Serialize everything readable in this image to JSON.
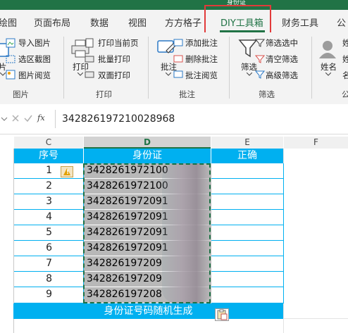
{
  "window": {
    "title": "身份证"
  },
  "tabs": [
    {
      "label": "绘图"
    },
    {
      "label": "页面布局"
    },
    {
      "label": "数据"
    },
    {
      "label": "视图"
    },
    {
      "label": "方方格子"
    },
    {
      "label": "DIY工具箱"
    },
    {
      "label": "财务工具"
    },
    {
      "label": "公"
    }
  ],
  "ribbon": {
    "picture": {
      "import": "导入图片",
      "area_screenshot": "选区截图",
      "browse": "图片阅览",
      "left_fragment": "片",
      "group": "图片"
    },
    "print": {
      "print": "打印",
      "print_current_page": "打印当前页",
      "batch_print": "批量打印",
      "duplex_print": "双面打印",
      "group": "打印"
    },
    "comment": {
      "comment": "批注",
      "add": "添加批注",
      "delete": "删除批注",
      "browse": "批注阅览",
      "group": "批注"
    },
    "filter": {
      "filter": "筛选",
      "filtered": "筛选选中",
      "clear": "清空筛选",
      "advanced": "高级筛选",
      "group": "筛选"
    },
    "name": {
      "name": "姓名",
      "frag1": "姓",
      "frag2": "姓",
      "frag3": "名",
      "group": "公"
    }
  },
  "formula_bar": {
    "fx": "fx",
    "value": "342826197210028968"
  },
  "columns": [
    "C",
    "D",
    "E",
    "F"
  ],
  "sheet": {
    "headers": {
      "seq": "序号",
      "id": "身份证",
      "correct": "正确"
    },
    "rows": [
      {
        "num": "1",
        "id": "3428261972100"
      },
      {
        "num": "2",
        "id": "3428261972100"
      },
      {
        "num": "3",
        "id": "3428261972091"
      },
      {
        "num": "4",
        "id": "3428261972091"
      },
      {
        "num": "5",
        "id": "3428261972091"
      },
      {
        "num": "6",
        "id": "3428261972091"
      },
      {
        "num": "7",
        "id": "342826197209"
      },
      {
        "num": "8",
        "id": "342826197209"
      },
      {
        "num": "9",
        "id": "342826197208"
      }
    ],
    "footer": "身份证号码随机生成"
  },
  "colors": {
    "excel_green": "#217346",
    "header_blue": "#00b0f0",
    "highlight_red": "#e23a3a"
  }
}
